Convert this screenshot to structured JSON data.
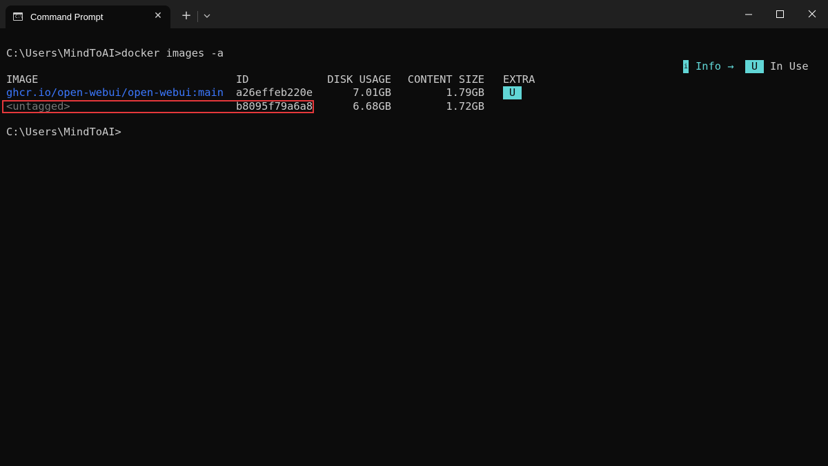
{
  "window": {
    "tab_title": "Command Prompt",
    "tab_icon": "terminal-icon",
    "tab_icon_glyph": "C:\\",
    "close_tab_glyph": "✕",
    "new_tab_glyph": "+"
  },
  "terminal": {
    "command_line": "C:\\Users\\MindToAI>docker images -a",
    "prompt_line": "C:\\Users\\MindToAI>",
    "legend": {
      "info_badge": "i",
      "info_label": "Info →",
      "inuse_badge": "U",
      "inuse_label": "In Use"
    },
    "table": {
      "headers": {
        "image": "IMAGE",
        "id": "ID",
        "disk_usage": "DISK USAGE",
        "content_size": "CONTENT SIZE",
        "extra": "EXTRA"
      },
      "rows": [
        {
          "image": "ghcr.io/open-webui/open-webui:main",
          "id": "a26effeb220e",
          "disk_usage": "7.01GB",
          "content_size": "1.79GB",
          "extra": "U"
        },
        {
          "image": "<untagged>",
          "id": "b8095f79a6a8",
          "disk_usage": "6.68GB",
          "content_size": "1.72GB",
          "extra": ""
        }
      ]
    }
  },
  "colors": {
    "background": "#0c0c0c",
    "titlebar": "#202020",
    "text": "#cccccc",
    "link": "#3b78ff",
    "untagged": "#767676",
    "badge": "#61d6d6",
    "highlight": "#e5383b"
  }
}
